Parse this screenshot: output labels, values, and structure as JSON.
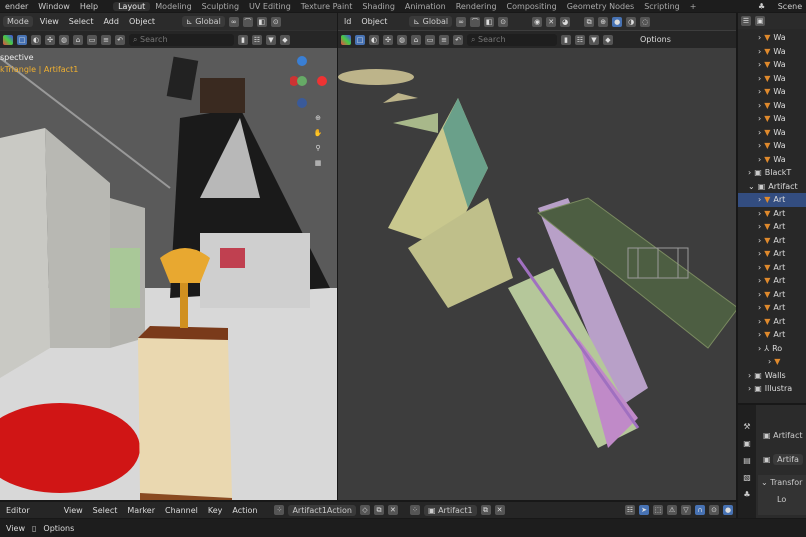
{
  "topbar": {
    "menus": [
      "ender",
      "Window",
      "Help"
    ],
    "tabs": [
      "Layout",
      "Modeling",
      "Sculpting",
      "UV Editing",
      "Texture Paint",
      "Shading",
      "Animation",
      "Rendering",
      "Compositing",
      "Geometry Nodes",
      "Scripting",
      "+"
    ],
    "active_tab": "Layout",
    "scene_label": "Scene"
  },
  "left_viewport": {
    "mode": "Mode",
    "menus": [
      "View",
      "Select",
      "Add",
      "Object"
    ],
    "orientation": "Global",
    "search_placeholder": "Search",
    "view_label": "spective",
    "object_path": "kTriangle | Artifact1"
  },
  "right_viewport": {
    "menus": [
      "ld",
      "Object"
    ],
    "orientation": "Global",
    "search_placeholder": "Search",
    "options_label": "Options"
  },
  "outliner": {
    "rows": [
      {
        "label": "Wa",
        "type": "mesh",
        "indent": 2
      },
      {
        "label": "Wa",
        "type": "mesh",
        "indent": 2
      },
      {
        "label": "Wa",
        "type": "mesh",
        "indent": 2
      },
      {
        "label": "Wa",
        "type": "mesh",
        "indent": 2
      },
      {
        "label": "Wa",
        "type": "mesh",
        "indent": 2
      },
      {
        "label": "Wa",
        "type": "mesh",
        "indent": 2
      },
      {
        "label": "Wa",
        "type": "mesh",
        "indent": 2
      },
      {
        "label": "Wa",
        "type": "mesh",
        "indent": 2
      },
      {
        "label": "Wa",
        "type": "mesh",
        "indent": 2
      },
      {
        "label": "Wa",
        "type": "mesh",
        "indent": 2
      },
      {
        "label": "BlackT",
        "type": "collection",
        "indent": 1
      },
      {
        "label": "Artifact",
        "type": "collection",
        "indent": 1,
        "expanded": true
      },
      {
        "label": "Art",
        "type": "mesh",
        "indent": 2,
        "selected": true
      },
      {
        "label": "Art",
        "type": "mesh",
        "indent": 2
      },
      {
        "label": "Art",
        "type": "mesh",
        "indent": 2
      },
      {
        "label": "Art",
        "type": "mesh",
        "indent": 2
      },
      {
        "label": "Art",
        "type": "mesh",
        "indent": 2
      },
      {
        "label": "Art",
        "type": "mesh",
        "indent": 2
      },
      {
        "label": "Art",
        "type": "mesh",
        "indent": 2
      },
      {
        "label": "Art",
        "type": "mesh",
        "indent": 2
      },
      {
        "label": "Art",
        "type": "mesh",
        "indent": 2
      },
      {
        "label": "Art",
        "type": "mesh",
        "indent": 2
      },
      {
        "label": "Art",
        "type": "mesh",
        "indent": 2
      },
      {
        "label": "Ro",
        "type": "empty",
        "indent": 2
      },
      {
        "label": "",
        "type": "mesh",
        "indent": 3
      },
      {
        "label": "Walls",
        "type": "collection",
        "indent": 1
      },
      {
        "label": "Illustra",
        "type": "collection",
        "indent": 1
      }
    ]
  },
  "properties": {
    "object_name": "Artifact",
    "data_name": "Artifa",
    "transform_label": "Transfor",
    "location_label": "Lo"
  },
  "dopesheet": {
    "editor": "Editor",
    "menus": [
      "View",
      "Select",
      "Marker",
      "Channel",
      "Key",
      "Action"
    ],
    "action_name": "Artifact1Action",
    "object_name": "Artifact1"
  },
  "status": {
    "items": [
      "View",
      "Options"
    ]
  },
  "colors": {
    "accent": "#4772b3",
    "selection": "#334d80",
    "mesh_icon": "#e08a2c"
  }
}
